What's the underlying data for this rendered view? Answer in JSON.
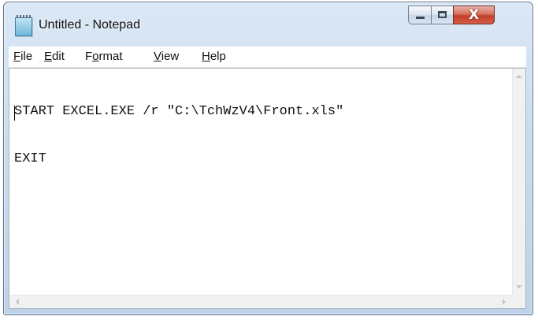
{
  "window": {
    "title": "Untitled - Notepad",
    "icon": "notepad-icon",
    "controls": {
      "minimize": "minimize-icon",
      "maximize": "maximize-icon",
      "close": "close-icon",
      "close_glyph": "X"
    }
  },
  "menu": [
    {
      "label": "File",
      "access_key": "F"
    },
    {
      "label": "Edit",
      "access_key": "E"
    },
    {
      "label": "Format",
      "access_key": "o"
    },
    {
      "label": "View",
      "access_key": "V"
    },
    {
      "label": "Help",
      "access_key": "H"
    }
  ],
  "editor": {
    "lines": [
      "START EXCEL.EXE /r \"C:\\TchWzV4\\Front.xls\"",
      "EXIT"
    ]
  },
  "colors": {
    "titlebar": "#c9dbef",
    "close_button": "#c2402b",
    "editor_background": "#ffffff"
  }
}
